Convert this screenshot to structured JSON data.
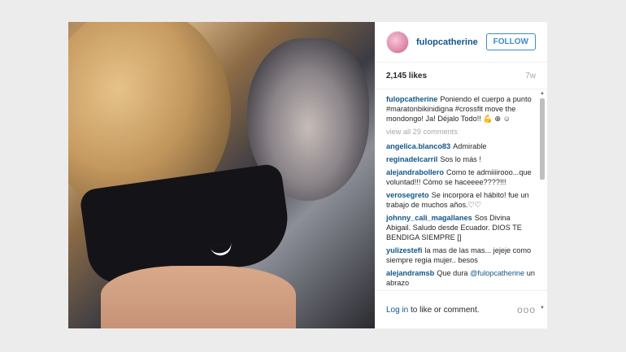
{
  "post": {
    "username": "fulopcatherine",
    "follow_label": "FOLLOW",
    "likes": "2,145 likes",
    "time": "7w",
    "caption": "Poniendo el cuerpo a punto #maratonbikinidigna #crossfit move the mondongo! Ja! Déjalo Todo!! 💪 ⊕ ☺",
    "caption_user": "fulopcatherine",
    "view_all": "view all 29 comments",
    "comments": [
      {
        "user": "angelica.blanco83",
        "text": "Admirable"
      },
      {
        "user": "reginadelcarril",
        "text": "Sos lo más !"
      },
      {
        "user": "alejandrabollero",
        "text": "Como te admiiiirooo...que voluntad!!! Cómo se haceeee????!!!"
      },
      {
        "user": "verosegreto",
        "text": "Se incorpora el hábito! fue un trabajo de muchos años.♡♡"
      },
      {
        "user": "johnny_cali_magallanes",
        "text": "Sos Divina Abigail. Saludo desde Ecuador. DIOS TE BENDIGA SIEMPRE []"
      },
      {
        "user": "yulizestefi",
        "text": "la mas de las mas... jejeje como siempre regia mujer.. besos"
      },
      {
        "user": "alejandramsb",
        "text": "Que dura",
        "mention": "@fulopcatherine",
        "tail": "un abrazo"
      }
    ],
    "footer": {
      "login_link": "Log in",
      "login_rest": "to like or comment.",
      "more": "ooo"
    }
  },
  "icons": {
    "scroll_up": "▲",
    "scroll_down": "▼"
  }
}
